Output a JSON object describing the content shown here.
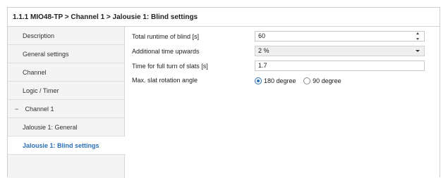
{
  "header": {
    "title": "1.1.1 MIO48-TP > Channel 1 > Jalousie 1: Blind settings"
  },
  "sidebar": {
    "items": [
      {
        "label": "Description"
      },
      {
        "label": "General settings"
      },
      {
        "label": "Channel"
      },
      {
        "label": "Logic / Timer"
      },
      {
        "label": "Channel 1",
        "expander": "−"
      },
      {
        "label": "Jalousie 1: General"
      },
      {
        "label": "Jalousie 1: Blind settings",
        "active": true
      }
    ]
  },
  "settings": {
    "total_runtime": {
      "label": "Total runtime of blind [s]",
      "value": "60"
    },
    "additional_time": {
      "label": "Additional time upwards",
      "value": "2 %"
    },
    "slat_turn_time": {
      "label": "Time for full turn of slats [s]",
      "value": "1.7"
    },
    "max_slat_angle": {
      "label": "Max. slat rotation angle",
      "options": [
        {
          "label": "180 degree",
          "checked": true
        },
        {
          "label": "90 degree",
          "checked": false
        }
      ]
    }
  },
  "icons": {
    "spinner": "spinner-arrows-icon",
    "dropdown": "chevron-down-icon",
    "expander": "minus-icon"
  },
  "colors": {
    "accent": "#2a6fb5",
    "sidebar_bg": "#f4f4f4",
    "select_bg": "#efefef"
  }
}
